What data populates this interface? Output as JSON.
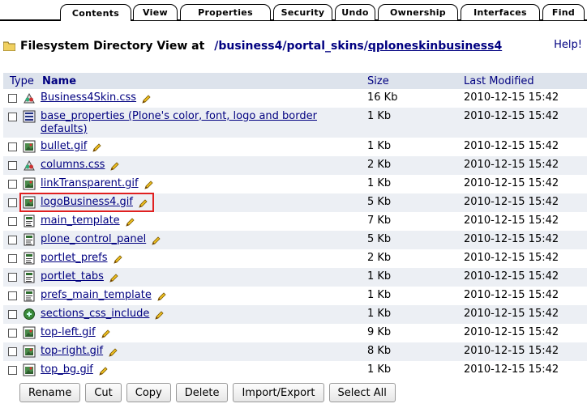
{
  "tabs": [
    {
      "label": "Contents",
      "active": true
    },
    {
      "label": "View"
    },
    {
      "label": "Properties"
    },
    {
      "label": "Security"
    },
    {
      "label": "Undo"
    },
    {
      "label": "Ownership"
    },
    {
      "label": "Interfaces"
    },
    {
      "label": "Find"
    }
  ],
  "header": {
    "title_label": "Filesystem Directory View at",
    "path": [
      "business4",
      "portal_skins",
      "qploneskinbusiness4"
    ],
    "path_sep": "/",
    "help": "Help!"
  },
  "columns": {
    "type": "Type",
    "name": "Name",
    "size": "Size",
    "modified": "Last Modified"
  },
  "files": [
    {
      "name": "Business4Skin.css",
      "size": "16 Kb",
      "modified": "2010-12-15 15:42",
      "icon": "css-icon"
    },
    {
      "name": "base_properties (Plone's color, font, logo and border defaults)",
      "size": "1 Kb",
      "modified": "2010-12-15 15:42",
      "icon": "properties-icon"
    },
    {
      "name": "bullet.gif",
      "size": "1 Kb",
      "modified": "2010-12-15 15:42",
      "icon": "image-icon"
    },
    {
      "name": "columns.css",
      "size": "2 Kb",
      "modified": "2010-12-15 15:42",
      "icon": "css-icon"
    },
    {
      "name": "linkTransparent.gif",
      "size": "1 Kb",
      "modified": "2010-12-15 15:42",
      "icon": "image-icon"
    },
    {
      "name": "logoBusiness4.gif",
      "size": "5 Kb",
      "modified": "2010-12-15 15:42",
      "icon": "image-icon",
      "highlighted": true
    },
    {
      "name": "main_template",
      "size": "7 Kb",
      "modified": "2010-12-15 15:42",
      "icon": "page-template-icon"
    },
    {
      "name": "plone_control_panel",
      "size": "5 Kb",
      "modified": "2010-12-15 15:42",
      "icon": "page-template-icon"
    },
    {
      "name": "portlet_prefs",
      "size": "2 Kb",
      "modified": "2010-12-15 15:42",
      "icon": "page-template-icon"
    },
    {
      "name": "portlet_tabs",
      "size": "1 Kb",
      "modified": "2010-12-15 15:42",
      "icon": "page-template-icon"
    },
    {
      "name": "prefs_main_template",
      "size": "1 Kb",
      "modified": "2010-12-15 15:42",
      "icon": "page-template-icon"
    },
    {
      "name": "sections_css_include",
      "size": "1 Kb",
      "modified": "2010-12-15 15:42",
      "icon": "script-icon"
    },
    {
      "name": "top-left.gif",
      "size": "9 Kb",
      "modified": "2010-12-15 15:42",
      "icon": "image-icon"
    },
    {
      "name": "top-right.gif",
      "size": "8 Kb",
      "modified": "2010-12-15 15:42",
      "icon": "image-icon"
    },
    {
      "name": "top_bg.gif",
      "size": "1 Kb",
      "modified": "2010-12-15 15:42",
      "icon": "image-icon"
    }
  ],
  "buttons": [
    "Rename",
    "Cut",
    "Copy",
    "Delete",
    "Import/Export",
    "Select All"
  ],
  "colors": {
    "link": "#000080",
    "header_bg": "#dde3ec",
    "row_alt_bg": "#eceff4",
    "highlight": "#e02020"
  }
}
